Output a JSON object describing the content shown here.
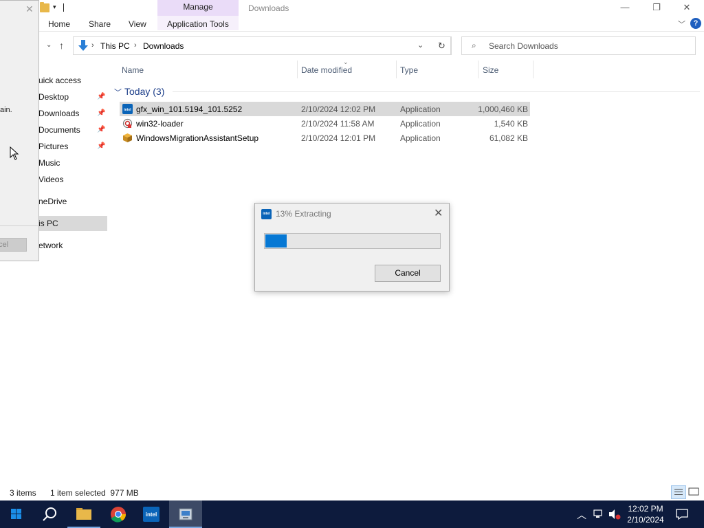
{
  "window": {
    "title": "Downloads",
    "manage_tab": "Manage",
    "app_tools_tab": "Application Tools",
    "ribbon_tabs": [
      "Home",
      "Share",
      "View"
    ],
    "minimize": "—",
    "restore": "❐",
    "close": "✕",
    "help": "?"
  },
  "address": {
    "crumbs": [
      "This PC",
      "Downloads"
    ],
    "search_placeholder": "Search Downloads"
  },
  "nav": {
    "items": [
      {
        "label": "uick access",
        "pinned": false
      },
      {
        "label": "Desktop",
        "pinned": true
      },
      {
        "label": "Downloads",
        "pinned": true
      },
      {
        "label": "Documents",
        "pinned": true
      },
      {
        "label": "Pictures",
        "pinned": true
      },
      {
        "label": "Music",
        "pinned": false
      },
      {
        "label": "Videos",
        "pinned": false
      },
      {
        "label": "neDrive",
        "pinned": false
      },
      {
        "label": "is PC",
        "pinned": false,
        "selected": true
      },
      {
        "label": "etwork",
        "pinned": false
      }
    ]
  },
  "bg_dialog": {
    "text": "ain.",
    "cancel": "ncel"
  },
  "columns": {
    "name": "Name",
    "date": "Date modified",
    "type": "Type",
    "size": "Size"
  },
  "group": {
    "label": "Today (3)"
  },
  "files": [
    {
      "name": "gfx_win_101.5194_101.5252",
      "date": "2/10/2024 12:02 PM",
      "type": "Application",
      "size": "1,000,460 KB",
      "icon": "intel-icon",
      "selected": true
    },
    {
      "name": "win32-loader",
      "date": "2/10/2024 11:58 AM",
      "type": "Application",
      "size": "1,540 KB",
      "icon": "loader-icon",
      "selected": false
    },
    {
      "name": "WindowsMigrationAssistantSetup",
      "date": "2/10/2024 12:01 PM",
      "type": "Application",
      "size": "61,082 KB",
      "icon": "package-icon",
      "selected": false
    }
  ],
  "dialog": {
    "title": "13% Extracting",
    "progress_percent": 13,
    "cancel": "Cancel",
    "icon_text": "intel"
  },
  "status": {
    "items_count": "3 items",
    "selection": "1 item selected  977 MB"
  },
  "taskbar": {
    "time": "12:02 PM",
    "date": "2/10/2024"
  },
  "colors": {
    "accent": "#0678d4",
    "taskbar": "#0d1b3d",
    "manage_tab": "#eadcf8",
    "group_header": "#1e3f8a"
  }
}
